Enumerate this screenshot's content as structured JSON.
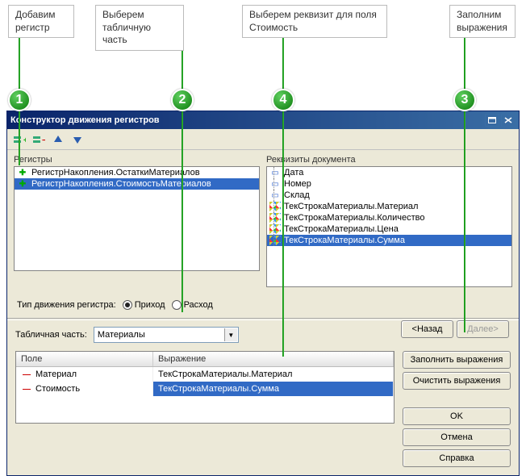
{
  "callouts": {
    "c1": "Добавим\nрегистр",
    "c2": "Выберем\nтабличную часть",
    "c3": "Заполним\nвыражения",
    "c4": "Выберем реквизит для поля\nСтоимость"
  },
  "badges": {
    "b1": "1",
    "b2": "2",
    "b3": "3",
    "b4": "4"
  },
  "window": {
    "title": "Конструктор движения регистров"
  },
  "registers": {
    "label": "Регистры",
    "items": [
      "РегистрНакопления.ОстаткиМатериалов",
      "РегистрНакопления.СтоимостьМатериалов"
    ]
  },
  "requisites": {
    "label": "Реквизиты документа",
    "items": [
      "Дата",
      "Номер",
      "Склад",
      "ТекСтрокаМатериалы.Материал",
      "ТекСтрокаМатериалы.Количество",
      "ТекСтрокаМатериалы.Цена",
      "ТекСтрокаМатериалы.Сумма"
    ]
  },
  "moveType": {
    "label": "Тип движения регистра:",
    "opt1": "Приход",
    "opt2": "Расход"
  },
  "tabular": {
    "label": "Табличная часть:",
    "value": "Материалы"
  },
  "grid": {
    "h1": "Поле",
    "h2": "Выражение",
    "rows": [
      {
        "f": "Материал",
        "e": "ТекСтрокаМатериалы.Материал"
      },
      {
        "f": "Стоимость",
        "e": "ТекСтрокаМатериалы.Сумма"
      }
    ]
  },
  "buttons": {
    "back": "<Назад",
    "next": "Далее>",
    "fill": "Заполнить выражения",
    "clear": "Очистить выражения",
    "ok": "OK",
    "cancel": "Отмена",
    "help": "Справка"
  }
}
